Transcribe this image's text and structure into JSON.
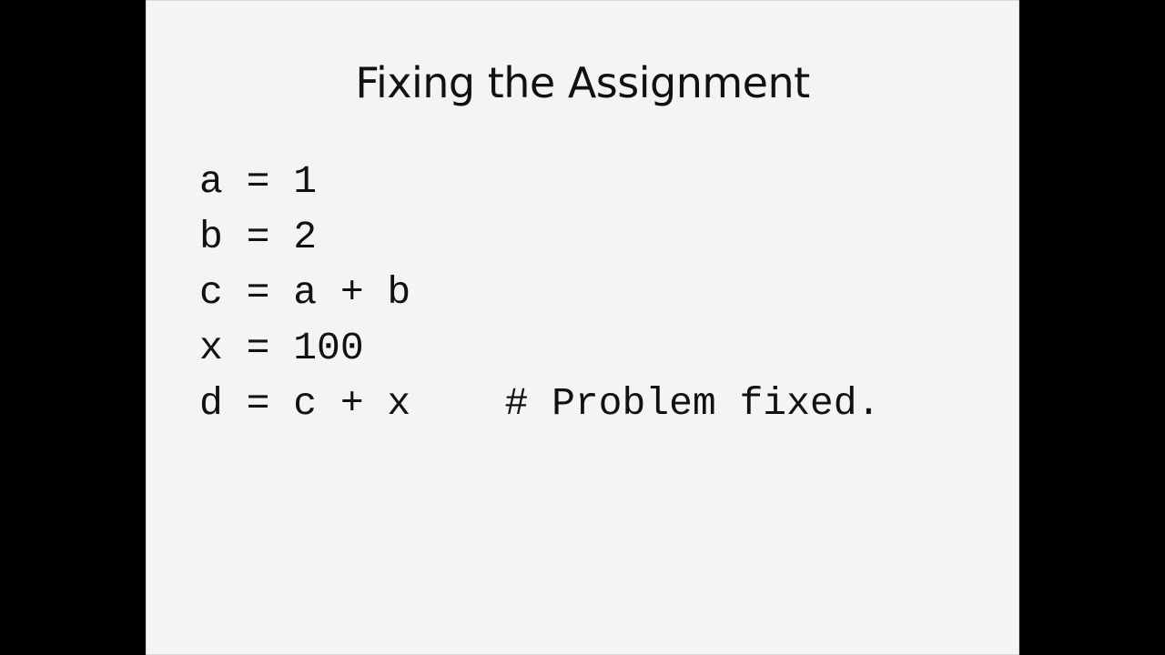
{
  "slide": {
    "title": "Fixing the Assignment",
    "code_lines": [
      "a = 1",
      "b = 2",
      "c = a + b",
      "x = 100",
      "d = c + x    # Problem fixed."
    ]
  }
}
